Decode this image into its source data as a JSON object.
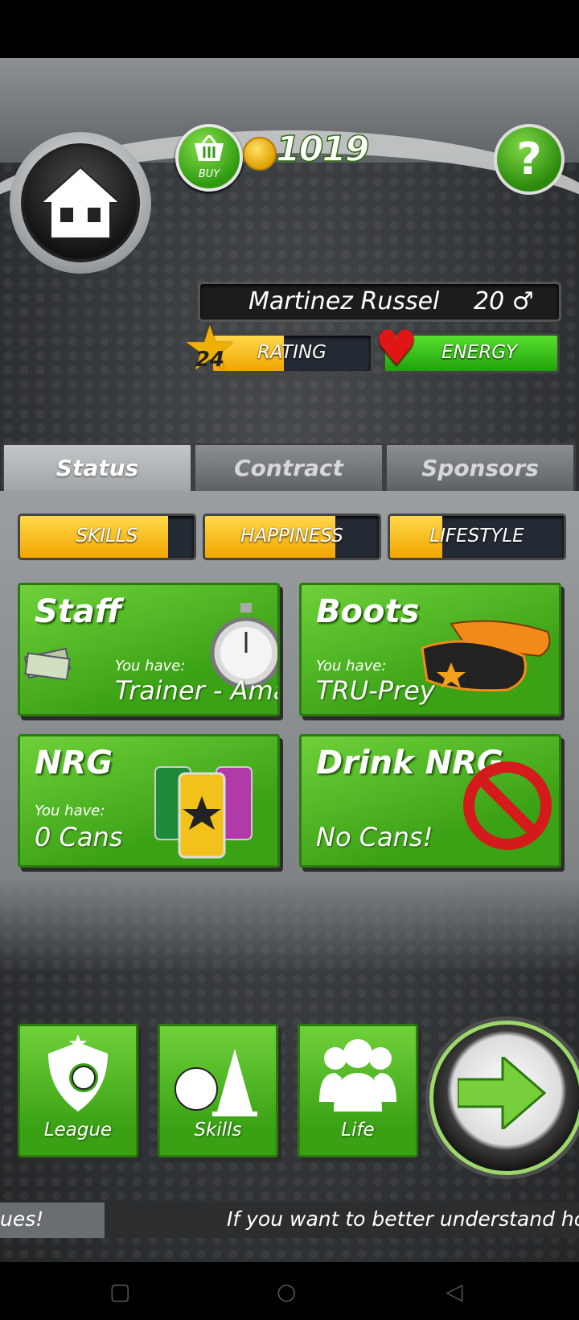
{
  "header": {
    "buy_label": "BUY",
    "coins": "1019",
    "help_label": "?"
  },
  "player": {
    "name": "Martinez Russel",
    "age": "20 ♂",
    "level": "24",
    "rating_label": "RATING",
    "rating_fill": 0.45,
    "energy_label": "ENERGY",
    "energy_fill": 1.0
  },
  "tabs": [
    {
      "label": "Status",
      "active": true
    },
    {
      "label": "Contract",
      "active": false
    },
    {
      "label": "Sponsors",
      "active": false
    }
  ],
  "stats": [
    {
      "label": "SKILLS",
      "fill": 0.85
    },
    {
      "label": "HAPPINESS",
      "fill": 0.75
    },
    {
      "label": "LIFESTYLE",
      "fill": 0.3
    }
  ],
  "cards": {
    "staff": {
      "title": "Staff",
      "you_have": "You have:",
      "value": "Trainer - Amat"
    },
    "boots": {
      "title": "Boots",
      "you_have": "You have:",
      "value": "TRU-Prey"
    },
    "nrg": {
      "title": "NRG",
      "you_have": "You have:",
      "value": "0 Cans"
    },
    "drink": {
      "title": "Drink NRG",
      "value": "No Cans!"
    }
  },
  "bottom_nav": {
    "league": "League",
    "skills": "Skills",
    "life": "Life"
  },
  "ticker": {
    "left_text": "ues!",
    "right_text": "If you want to better understand how to"
  },
  "colors": {
    "accent_green": "#3ba115",
    "bar_yellow": "#f2a500",
    "heart_red": "#e01515"
  }
}
